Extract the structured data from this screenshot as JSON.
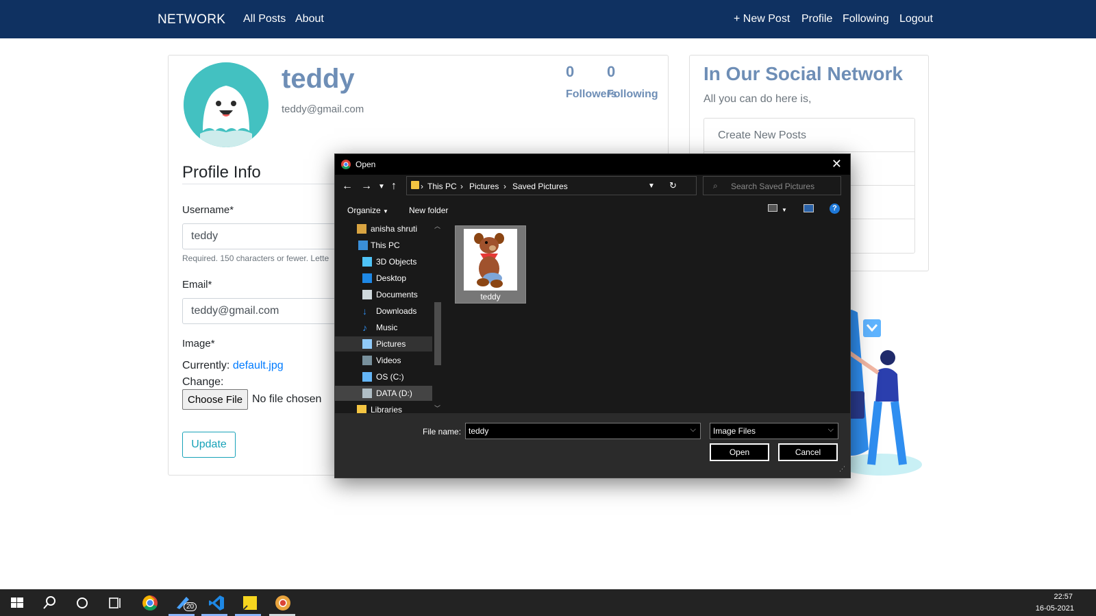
{
  "navbar": {
    "brand": "NETWORK",
    "left_links": [
      "All Posts",
      "About"
    ],
    "right_links": [
      "+ New Post",
      "Profile",
      "Following",
      "Logout"
    ],
    "bg_color": "#0f3161"
  },
  "profile": {
    "username": "teddy",
    "email": "teddy@gmail.com",
    "followers_count": "0",
    "following_count": "0",
    "followers_label": "Followers",
    "following_label": "Following"
  },
  "form": {
    "section_title": "Profile Info",
    "username_label": "Username*",
    "username_value": "teddy",
    "username_help": "Required. 150 characters or fewer. Lette",
    "email_label": "Email*",
    "email_value": "teddy@gmail.com",
    "image_label": "Image*",
    "currently_label": "Currently:",
    "currently_file": "default.jpg",
    "change_label": "Change:",
    "choose_file_button": "Choose File",
    "file_status": "No file chosen",
    "update_button": "Update"
  },
  "sidebar": {
    "title": "In Our Social Network",
    "subtitle": "All you can do here is,",
    "items": [
      "Create New Posts"
    ]
  },
  "dialog": {
    "title": "Open",
    "breadcrumb": [
      "This PC",
      "Pictures",
      "Saved Pictures"
    ],
    "search_placeholder": "Search Saved Pictures",
    "organize_label": "Organize",
    "new_folder_label": "New folder",
    "tree": [
      {
        "label": "anisha shruti",
        "icon": "user-folder-icon"
      },
      {
        "label": "This PC",
        "icon": "pc-icon"
      },
      {
        "label": "3D Objects",
        "icon": "cube-icon"
      },
      {
        "label": "Desktop",
        "icon": "desktop-icon"
      },
      {
        "label": "Documents",
        "icon": "document-icon"
      },
      {
        "label": "Downloads",
        "icon": "download-icon"
      },
      {
        "label": "Music",
        "icon": "music-icon"
      },
      {
        "label": "Pictures",
        "icon": "pictures-icon"
      },
      {
        "label": "Videos",
        "icon": "video-icon"
      },
      {
        "label": "OS (C:)",
        "icon": "drive-icon"
      },
      {
        "label": "DATA (D:)",
        "icon": "drive-icon"
      },
      {
        "label": "Libraries",
        "icon": "library-icon"
      }
    ],
    "file": {
      "name": "teddy"
    },
    "file_name_label": "File name:",
    "file_name_value": "teddy",
    "filter_value": "Image Files",
    "open_button": "Open",
    "cancel_button": "Cancel"
  },
  "taskbar": {
    "badge_count": "20",
    "time": "22:57",
    "date": "16-05-2021"
  }
}
